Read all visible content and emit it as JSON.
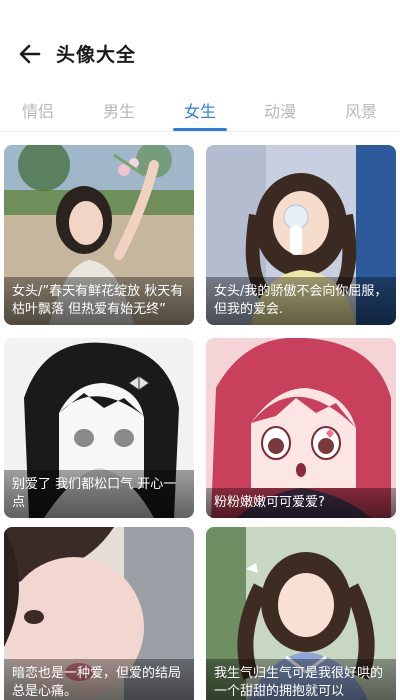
{
  "header": {
    "title": "头像大全",
    "back_icon": "arrow-left-icon"
  },
  "tabs": [
    {
      "label": "情侣",
      "active": false
    },
    {
      "label": "男生",
      "active": false
    },
    {
      "label": "女生",
      "active": true
    },
    {
      "label": "动漫",
      "active": false
    },
    {
      "label": "风景",
      "active": false
    }
  ],
  "colors": {
    "accent": "#2a7de1",
    "tab_inactive": "#b8b8b8"
  },
  "cards": [
    {
      "caption": "女头/”春天有鲜花绽放 秋天有枯叶飘落 但热爱有始无终”"
    },
    {
      "caption": "女头/我的骄傲不会向你屈服，但我的爱会."
    },
    {
      "caption": "别爱了 我们都松口气 开心一点"
    },
    {
      "caption": "粉粉嫩嫩可可爱爱?"
    },
    {
      "caption": "暗恋也是一种爱，但爱的结局总是心痛。"
    },
    {
      "caption": "我生气归生气可是我很好哄的一个甜甜的拥抱就可以"
    }
  ]
}
